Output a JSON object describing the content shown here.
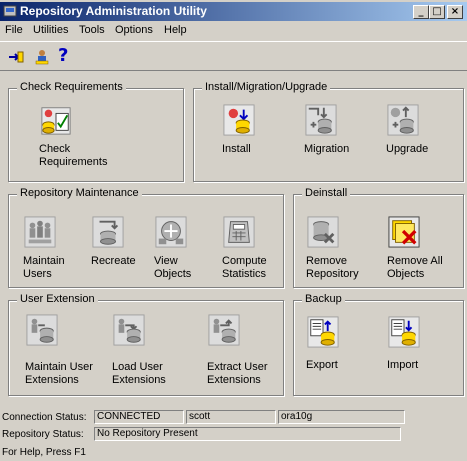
{
  "window": {
    "title": "Repository Administration Utility"
  },
  "title_buttons": {
    "minimize": "_",
    "maximize": "□",
    "close": "×"
  },
  "menu": {
    "items": [
      "File",
      "Utilities",
      "Tools",
      "Options",
      "Help"
    ]
  },
  "toolbar": {
    "help_label": "?"
  },
  "groups": {
    "check": {
      "title": "Check Requirements",
      "items": [
        {
          "label": "Check\nRequirements"
        }
      ]
    },
    "install": {
      "title": "Install/Migration/Upgrade",
      "items": [
        {
          "label": "Install"
        },
        {
          "label": "Migration"
        },
        {
          "label": "Upgrade"
        }
      ]
    },
    "maintenance": {
      "title": "Repository Maintenance",
      "items": [
        {
          "label": "Maintain\nUsers"
        },
        {
          "label": "Recreate"
        },
        {
          "label": "View\nObjects"
        },
        {
          "label": "Compute\nStatistics"
        }
      ]
    },
    "deinstall": {
      "title": "Deinstall",
      "items": [
        {
          "label": "Remove\nRepository"
        },
        {
          "label": "Remove All\nObjects"
        }
      ]
    },
    "extension": {
      "title": "User Extension",
      "items": [
        {
          "label": "Maintain User\nExtensions"
        },
        {
          "label": "Load User\nExtensions"
        },
        {
          "label": "Extract User\nExtensions"
        }
      ]
    },
    "backup": {
      "title": "Backup",
      "items": [
        {
          "label": "Export"
        },
        {
          "label": "Import"
        }
      ]
    }
  },
  "status": {
    "connection_label": "Connection Status:",
    "connection_value": "CONNECTED",
    "user": "scott",
    "database": "ora10g",
    "repository_label": "Repository Status:",
    "repository_value": "No Repository Present",
    "help_text": "For Help, Press F1"
  },
  "colors": {
    "title_start": "#0a246a",
    "title_end": "#a6caf0",
    "face": "#d4d0c8"
  }
}
